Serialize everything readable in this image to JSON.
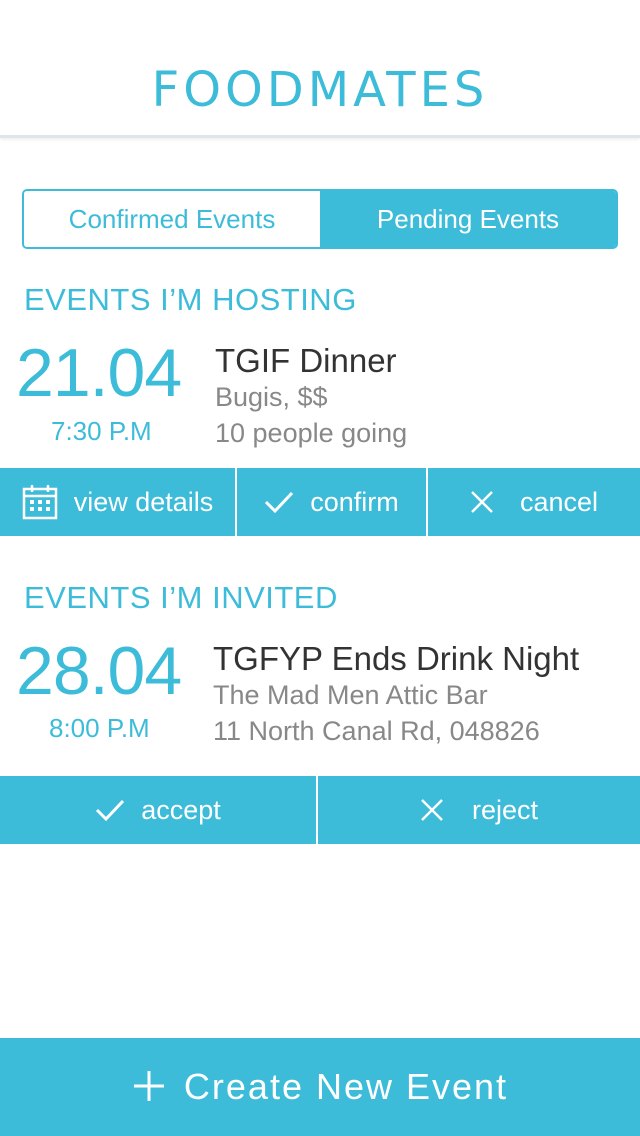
{
  "header": {
    "title": "FOODMATES"
  },
  "tabs": {
    "confirmed_label": "Confirmed Events",
    "pending_label": "Pending Events",
    "active": "Pending Events"
  },
  "hosting": {
    "heading": "EVENTS I’M HOSTING",
    "event": {
      "date": "21.04",
      "time": "7:30 P.M",
      "title": "TGIF Dinner",
      "location": "Bugis, $$",
      "attendees": "10 people going"
    },
    "actions": {
      "view_details": "view details",
      "confirm": "confirm",
      "cancel": "cancel"
    }
  },
  "invited": {
    "heading": "EVENTS I’M INVITED",
    "event": {
      "date": "28.04",
      "time": "8:00 P.M",
      "title": "TGFYP Ends Drink Night",
      "venue": "The Mad Men Attic Bar",
      "address": "11 North Canal Rd, 048826"
    },
    "actions": {
      "accept": "accept",
      "reject": "reject"
    }
  },
  "footer": {
    "create_label": "Create New Event",
    "icon": "plus-icon"
  },
  "colors": {
    "accent": "#3dbcd9",
    "text_dark": "#333333",
    "text_muted": "#888888"
  }
}
